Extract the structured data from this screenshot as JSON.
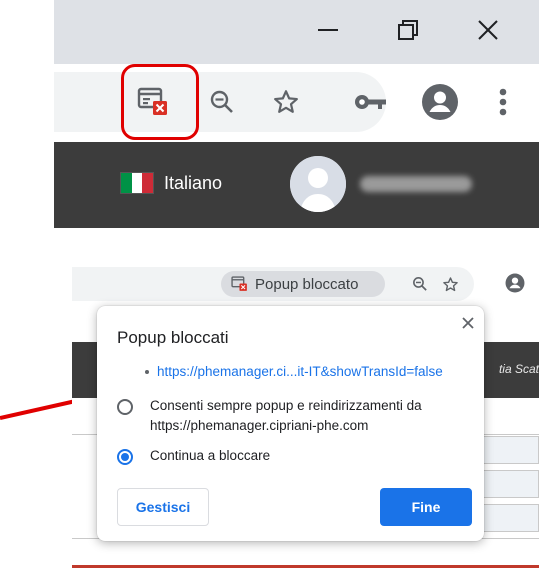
{
  "colors": {
    "highlight": "#e00000",
    "arrow": "#e00000",
    "accent": "#1a73e8",
    "page_header": "#3c3c3c",
    "titlebar": "#dee1e6"
  },
  "top_panel": {
    "window_controls": [
      "minimize-icon",
      "restore-icon",
      "close-icon"
    ],
    "toolbar_icons": [
      "popup-blocked-icon",
      "zoom-out-icon",
      "star-icon",
      "key-icon",
      "account-icon",
      "kebab-menu-icon"
    ],
    "page_header": {
      "language_label": "Italiano",
      "flag": "italy-flag-icon"
    }
  },
  "bottom_panel": {
    "chip_label": "Popup bloccato",
    "toolbar_icons": [
      "zoom-out-icon",
      "star-icon",
      "account-icon"
    ],
    "page_header_text": "tia Scat"
  },
  "dialog": {
    "title": "Popup bloccati",
    "blocked_url": "https://phemanager.ci...it-IT&showTransId=false",
    "option_allow_line1": "Consenti sempre popup e reindirizzamenti da",
    "option_allow_line2": "https://phemanager.cipriani-phe.com",
    "option_allow_checked": false,
    "option_block": "Continua a bloccare",
    "option_block_checked": true,
    "manage_label": "Gestisci",
    "done_label": "Fine"
  }
}
